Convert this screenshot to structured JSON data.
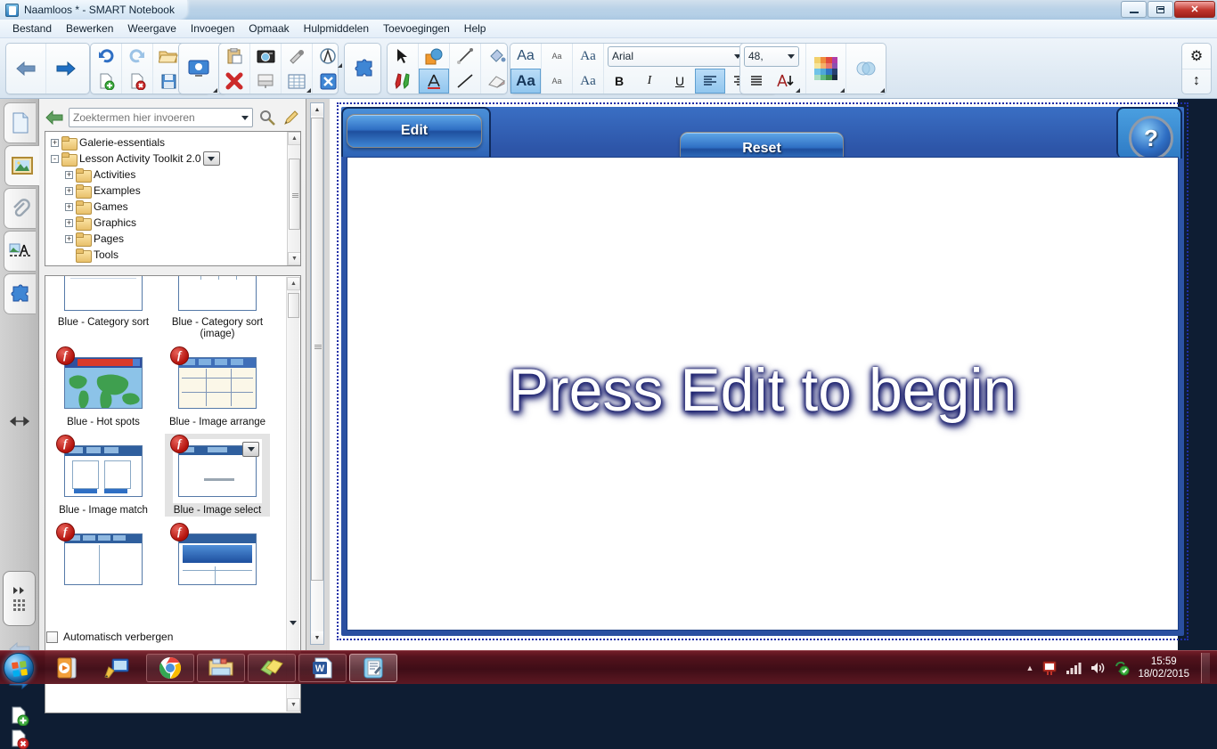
{
  "window": {
    "title": "Naamloos * - SMART Notebook",
    "app_icon": "notebook-icon",
    "controls": {
      "minimize": "minimize-icon",
      "restore": "restore-icon",
      "close": "✕"
    }
  },
  "menubar": {
    "items": [
      {
        "label": "Bestand"
      },
      {
        "label": "Bewerken"
      },
      {
        "label": "Weergave"
      },
      {
        "label": "Invoegen"
      },
      {
        "label": "Opmaak"
      },
      {
        "label": "Hulpmiddelen"
      },
      {
        "label": "Toevoegingen"
      },
      {
        "label": "Help"
      }
    ]
  },
  "toolbar": {
    "nav": {
      "previous": "←",
      "next": "→"
    },
    "font_family": "Arial",
    "font_size": "48,",
    "bold": "B",
    "italic": "I",
    "underline": "U",
    "text_sample": "Aa",
    "text_sample_small": "Aa",
    "text_sample_italic": "Aa",
    "right_buttons": {
      "customize": "⚙",
      "move": "↕"
    }
  },
  "sidebar": {
    "tabs": [
      {
        "name": "page-sorter",
        "label": "Paginasorteerfunctie"
      },
      {
        "name": "gallery",
        "label": "Galerie",
        "active": true
      },
      {
        "name": "attachments",
        "label": "Bijlagen"
      },
      {
        "name": "properties",
        "label": "Eigenschappen"
      },
      {
        "name": "add-ons",
        "label": "Toevoegingen"
      }
    ]
  },
  "gallery": {
    "search": {
      "placeholder": "Zoektermen hier invoeren",
      "value": ""
    },
    "tree": [
      {
        "label": "Galerie-essentials",
        "depth": 0,
        "expander": "+"
      },
      {
        "label": "Lesson Activity Toolkit 2.0",
        "depth": 0,
        "expander": "-",
        "has_dropdown": true
      },
      {
        "label": "Activities",
        "depth": 1,
        "expander": "+"
      },
      {
        "label": "Examples",
        "depth": 1,
        "expander": "+"
      },
      {
        "label": "Games",
        "depth": 1,
        "expander": "+"
      },
      {
        "label": "Graphics",
        "depth": 1,
        "expander": "+"
      },
      {
        "label": "Pages",
        "depth": 1,
        "expander": "+"
      },
      {
        "label": "Tools",
        "depth": 1,
        "expander": ""
      }
    ],
    "items": [
      {
        "label": "Blue - Category sort",
        "badge": false,
        "partial": true
      },
      {
        "label": "Blue - Category sort (image)",
        "badge": false,
        "partial": true
      },
      {
        "label": "Blue - Hot spots",
        "badge": true
      },
      {
        "label": "Blue - Image arrange",
        "badge": true
      },
      {
        "label": "Blue - Image match",
        "badge": true
      },
      {
        "label": "Blue - Image select",
        "badge": true,
        "selected": true
      },
      {
        "label": "",
        "badge": true
      },
      {
        "label": "",
        "badge": true
      }
    ],
    "autohide": {
      "label": "Automatisch verbergen",
      "checked": false
    }
  },
  "canvas": {
    "activity": {
      "edit_button": "Edit",
      "reset_button": "Reset",
      "help_button": "?",
      "message": "Press Edit to begin"
    }
  },
  "taskbar": {
    "start": "start-orb",
    "quicklaunch": [
      {
        "name": "media-player-icon"
      },
      {
        "name": "smart-ink-icon"
      }
    ],
    "windows": [
      {
        "name": "chrome-icon",
        "active": false
      },
      {
        "name": "explorer-icon",
        "active": false
      },
      {
        "name": "sticky-notes-icon",
        "active": false
      },
      {
        "name": "word-icon",
        "active": false
      },
      {
        "name": "smart-notebook-icon",
        "active": true
      }
    ],
    "tray": {
      "expand": "▲",
      "icons": [
        "smart-board-icon",
        "network-icon",
        "volume-icon",
        "smart-sync-icon"
      ],
      "time": "15:59",
      "date": "18/02/2015"
    }
  },
  "colors": {
    "accent_blue": "#2f66a8",
    "title_blue": "#12263a",
    "taskbar_maroon": "#400c16",
    "flash_red": "#b3120c"
  }
}
